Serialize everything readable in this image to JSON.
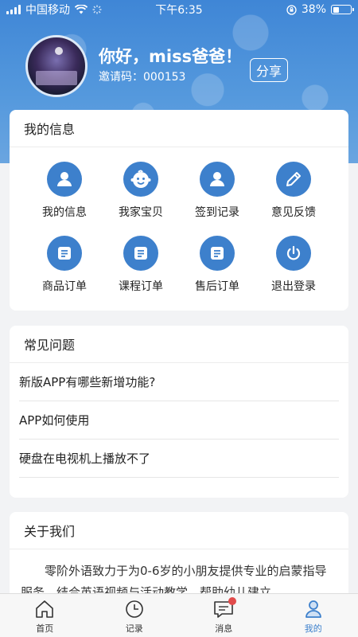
{
  "status_bar": {
    "carrier": "中国移动",
    "time": "下午6:35",
    "battery_percent": "38%",
    "battery_level": 0.38
  },
  "profile": {
    "greeting": "你好，miss爸爸！",
    "invite_code": "邀请码：000153",
    "share_label": "分享"
  },
  "my_info": {
    "title": "我的信息",
    "items": [
      {
        "label": "我的信息",
        "icon": "user-icon"
      },
      {
        "label": "我家宝贝",
        "icon": "baby-face-icon"
      },
      {
        "label": "签到记录",
        "icon": "user-icon"
      },
      {
        "label": "意见反馈",
        "icon": "pencil-icon"
      },
      {
        "label": "商品订单",
        "icon": "document-icon"
      },
      {
        "label": "课程订单",
        "icon": "document-icon"
      },
      {
        "label": "售后订单",
        "icon": "document-icon"
      },
      {
        "label": "退出登录",
        "icon": "power-icon"
      }
    ]
  },
  "faq": {
    "title": "常见问题",
    "items": [
      "新版APP有哪些新增功能?",
      "APP如何使用",
      "硬盘在电视机上播放不了"
    ]
  },
  "about": {
    "title": "关于我们",
    "text": "零阶外语致力于为0-6岁的小朋友提供专业的启蒙指导服务，结合英语视频与活动教学，帮助幼儿建立"
  },
  "tabs": [
    {
      "label": "首页",
      "icon": "home-icon",
      "active": false
    },
    {
      "label": "记录",
      "icon": "clock-icon",
      "active": false
    },
    {
      "label": "消息",
      "icon": "message-icon",
      "active": false
    },
    {
      "label": "我的",
      "icon": "profile-icon",
      "active": true
    }
  ],
  "colors": {
    "accent": "#3d80cc",
    "header": "#4a8fd9",
    "badge": "#e14b4b"
  }
}
